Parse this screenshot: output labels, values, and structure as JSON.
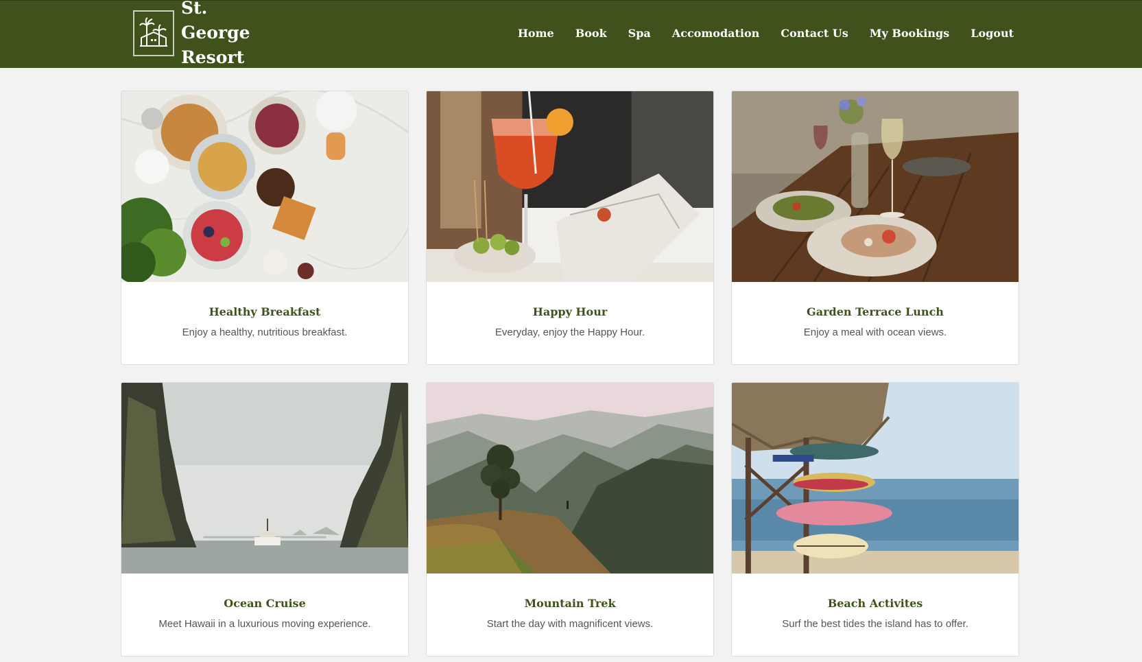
{
  "brand": {
    "line1": "St. George",
    "line2": "Resort",
    "logo_icon": "palm-house-icon"
  },
  "colors": {
    "header_bg": "#3f521c",
    "title_color": "#3f521c",
    "page_bg": "#f2f2f2"
  },
  "nav": {
    "items": [
      {
        "label": "Home"
      },
      {
        "label": "Book"
      },
      {
        "label": "Spa"
      },
      {
        "label": "Accomodation"
      },
      {
        "label": "Contact Us"
      },
      {
        "label": "My Bookings"
      },
      {
        "label": "Logout"
      }
    ]
  },
  "cards": [
    {
      "title": "Healthy Breakfast",
      "text": "Enjoy a healthy, nutritious breakfast.",
      "image": "breakfast-photo"
    },
    {
      "title": "Happy Hour",
      "text": "Everyday, enjoy the Happy Hour.",
      "image": "cocktail-photo"
    },
    {
      "title": "Garden Terrace Lunch",
      "text": "Enjoy a meal with ocean views.",
      "image": "lunch-table-photo"
    },
    {
      "title": "Ocean Cruise",
      "text": "Meet Hawaii in a luxurious moving experience.",
      "image": "cruise-cliffs-photo"
    },
    {
      "title": "Mountain Trek",
      "text": "Start the day with magnificent views.",
      "image": "mountain-valley-photo"
    },
    {
      "title": "Beach Activites",
      "text": "Surf the best tides the island has to offer.",
      "image": "surfboards-beach-photo"
    }
  ]
}
